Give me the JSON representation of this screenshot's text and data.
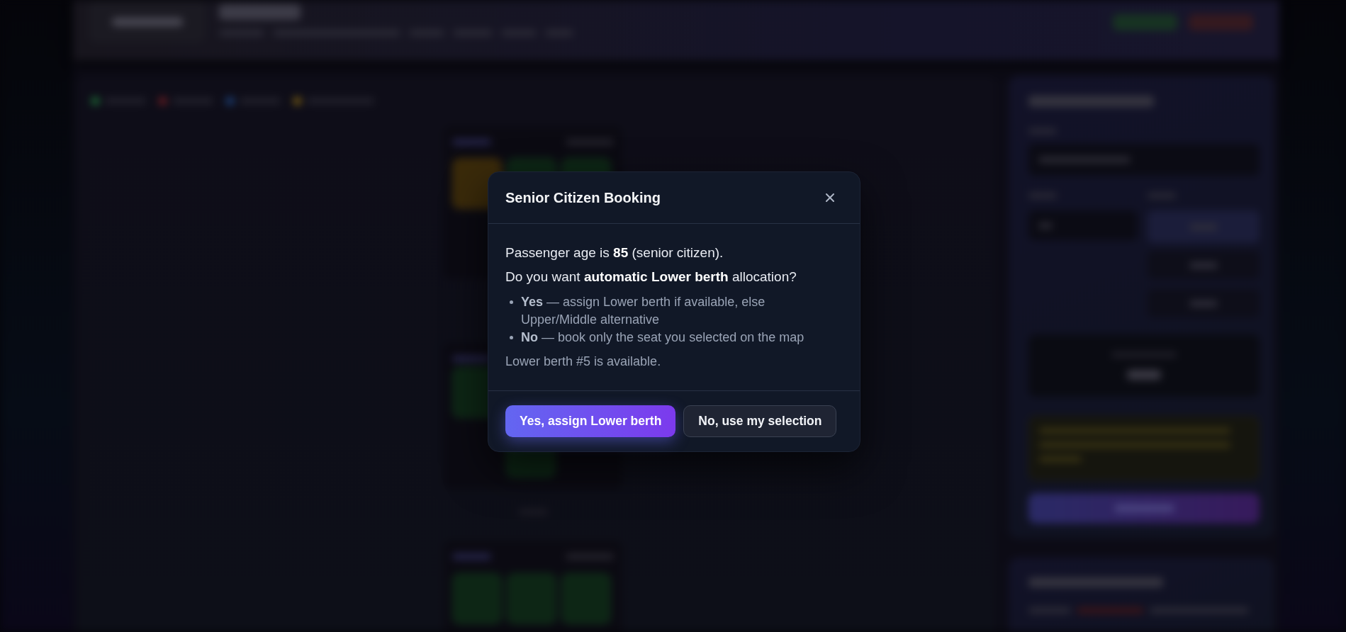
{
  "dialog": {
    "title": "Senior Citizen Booking",
    "message": "Passenger age is **85** (senior citizen).",
    "question": "Do you want **automatic Lower berth** allocation?",
    "options": [
      "**Yes** — assign Lower berth if available, else Upper/Middle alternative",
      "**No** — book only the seat you selected on the map"
    ],
    "note": "Lower berth #5 is available.",
    "buttons": [
      {
        "kind": "primary",
        "label": "Yes, assign Lower berth"
      },
      {
        "kind": "secondary",
        "label": "No, use my selection"
      }
    ]
  }
}
